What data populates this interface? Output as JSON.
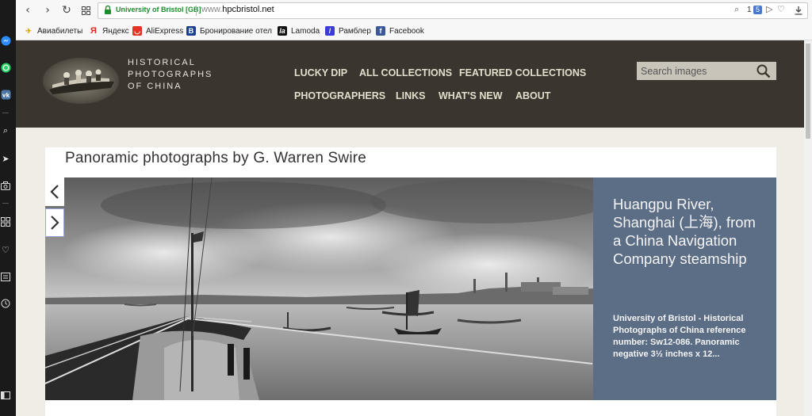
{
  "browser": {
    "site_identity": "University of Bristol [GB]",
    "url_prefix": "www.",
    "url_domain": "hpcbristol.net",
    "adblock_count": "1",
    "adblock_badge": "5"
  },
  "bookmarks": [
    {
      "label": "Авиабилеты",
      "icon": "plane-icon"
    },
    {
      "label": "Яндекс",
      "icon": "yandex-icon"
    },
    {
      "label": "AliExpress",
      "icon": "aliexpress-icon"
    },
    {
      "label": "Бронирование отел",
      "icon": "booking-icon"
    },
    {
      "label": "Lamoda",
      "icon": "lamoda-icon"
    },
    {
      "label": "Рамблер",
      "icon": "rambler-icon"
    },
    {
      "label": "Facebook",
      "icon": "facebook-icon"
    }
  ],
  "site": {
    "logo_lines": [
      "HISTORICAL",
      "PHOTOGRAPHS",
      "OF CHINA"
    ],
    "nav": [
      "LUCKY DIP",
      "ALL COLLECTIONS",
      "FEATURED COLLECTIONS",
      "PHOTOGRAPHERS",
      "LINKS",
      "WHAT'S NEW",
      "ABOUT"
    ],
    "search_placeholder": "Search images"
  },
  "content": {
    "title": "Panoramic photographs by G. Warren Swire",
    "slide": {
      "caption_title": "Huangpu River, Shanghai (上海), from a China Navigation Company steamship",
      "caption_desc": "University of Bristol - Historical Photographs of China reference number: Sw12-086. Panoramic negative 3½ inches x 12..."
    }
  },
  "colors": {
    "header_bg": "#3a352f",
    "caption_bg": "#5c6d86",
    "page_bg": "#efede6",
    "secure_green": "#1f8c2d"
  }
}
